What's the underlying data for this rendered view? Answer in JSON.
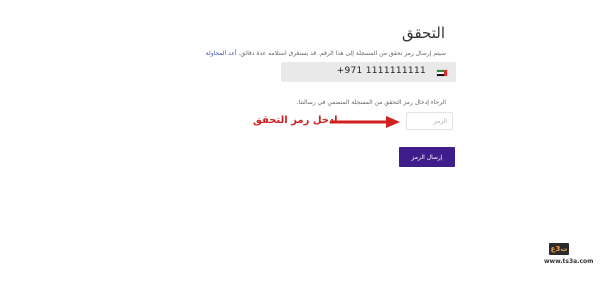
{
  "page": {
    "title": "التحقق"
  },
  "verification": {
    "info_text": "سيتم إرسال رمز تحقق من المسجلة إلى هذا الرقم. قد يستغرق استلامه عدة دقائق.",
    "resend_link": "أعد المحاولة",
    "phone_number": "+971 1111111111",
    "country_flag_icon": "uae-flag-icon",
    "instruction": "الرجاء إدخال رمز التحقق من المسجلة المتضمن في رسالتنا.",
    "code_placeholder": "الرمز",
    "send_button_label": "إرسال الرمز"
  },
  "annotation": {
    "text": "ادخل رمز التحقق",
    "color": "#d02020"
  },
  "watermark": {
    "logo_text": "ت3ع",
    "url": "www.ts3a.com"
  },
  "colors": {
    "button": "#3f1d8a",
    "link": "#3b4fc7",
    "phone_box": "#e9e9e9"
  }
}
